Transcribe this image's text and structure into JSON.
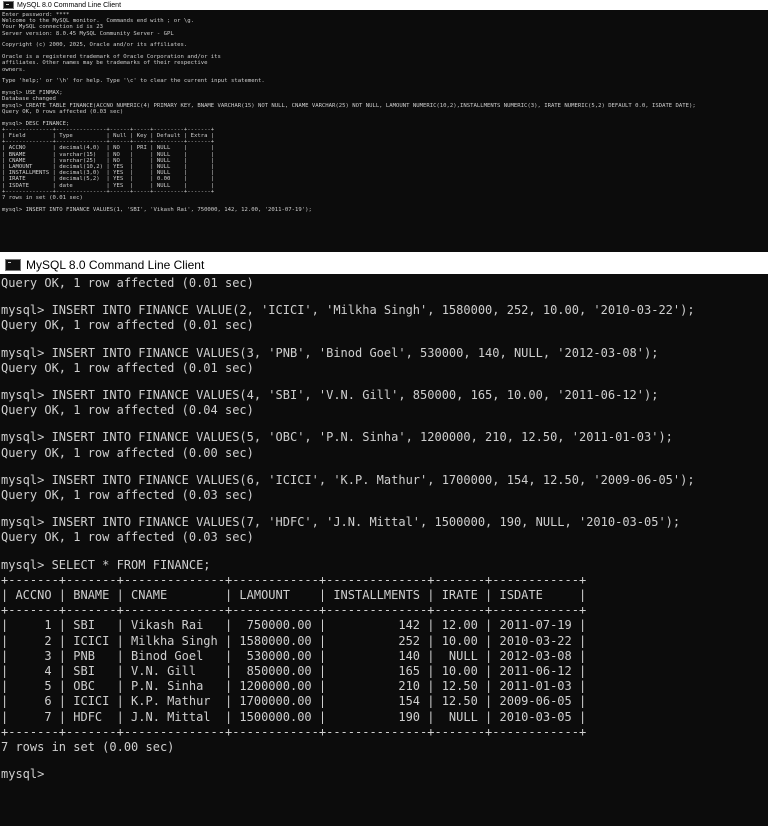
{
  "window1": {
    "title": "MySQL 8.0 Command Line Client",
    "lines": [
      "Enter password: ****",
      "Welcome to the MySQL monitor.  Commands end with ; or \\g.",
      "Your MySQL connection id is 23",
      "Server version: 8.0.45 MySQL Community Server - GPL",
      "",
      "Copyright (c) 2000, 2025, Oracle and/or its affiliates.",
      "",
      "Oracle is a registered trademark of Oracle Corporation and/or its",
      "affiliates. Other names may be trademarks of their respective",
      "owners.",
      "",
      "Type 'help;' or '\\h' for help. Type '\\c' to clear the current input statement.",
      "",
      "mysql> USE FINMAX;",
      "Database changed",
      "mysql> CREATE TABLE FINANCE(ACCNO NUMERIC(4) PRIMARY KEY, BNAME VARCHAR(15) NOT NULL, CNAME VARCHAR(25) NOT NULL, LAMOUNT NUMERIC(10,2),INSTALLMENTS NUMERIC(3), IRATE NUMERIC(5,2) DEFAULT 0.0, ISDATE DATE);",
      "Query OK, 0 rows affected (0.03 sec)",
      "",
      "mysql> DESC FINANCE;",
      "+--------------+---------------+------+-----+---------+-------+",
      "| Field        | Type          | Null | Key | Default | Extra |",
      "+--------------+---------------+------+-----+---------+-------+",
      "| ACCNO        | decimal(4,0)  | NO   | PRI | NULL    |       |",
      "| BNAME        | varchar(15)   | NO   |     | NULL    |       |",
      "| CNAME        | varchar(25)   | NO   |     | NULL    |       |",
      "| LAMOUNT      | decimal(10,2) | YES  |     | NULL    |       |",
      "| INSTALLMENTS | decimal(3,0)  | YES  |     | NULL    |       |",
      "| IRATE        | decimal(5,2)  | YES  |     | 0.00    |       |",
      "| ISDATE       | date          | YES  |     | NULL    |       |",
      "+--------------+---------------+------+-----+---------+-------+",
      "7 rows in set (0.01 sec)",
      "",
      "mysql> INSERT INTO FINANCE VALUES(1, 'SBI', 'Vikash Rai', 750000, 142, 12.00, '2011-07-19');"
    ]
  },
  "window2": {
    "title": "MySQL 8.0 Command Line Client",
    "lines": [
      "Query OK, 1 row affected (0.01 sec)",
      "",
      "mysql> INSERT INTO FINANCE VALUE(2, 'ICICI', 'Milkha Singh', 1580000, 252, 10.00, '2010-03-22');",
      "Query OK, 1 row affected (0.01 sec)",
      "",
      "mysql> INSERT INTO FINANCE VALUES(3, 'PNB', 'Binod Goel', 530000, 140, NULL, '2012-03-08');",
      "Query OK, 1 row affected (0.01 sec)",
      "",
      "mysql> INSERT INTO FINANCE VALUES(4, 'SBI', 'V.N. Gill', 850000, 165, 10.00, '2011-06-12');",
      "Query OK, 1 row affected (0.04 sec)",
      "",
      "mysql> INSERT INTO FINANCE VALUES(5, 'OBC', 'P.N. Sinha', 1200000, 210, 12.50, '2011-01-03');",
      "Query OK, 1 row affected (0.00 sec)",
      "",
      "mysql> INSERT INTO FINANCE VALUES(6, 'ICICI', 'K.P. Mathur', 1700000, 154, 12.50, '2009-06-05');",
      "Query OK, 1 row affected (0.03 sec)",
      "",
      "mysql> INSERT INTO FINANCE VALUES(7, 'HDFC', 'J.N. Mittal', 1500000, 190, NULL, '2010-03-05');",
      "Query OK, 1 row affected (0.03 sec)",
      "",
      "mysql> SELECT * FROM FINANCE;",
      "+-------+-------+--------------+------------+--------------+-------+------------+",
      "| ACCNO | BNAME | CNAME        | LAMOUNT    | INSTALLMENTS | IRATE | ISDATE     |",
      "+-------+-------+--------------+------------+--------------+-------+------------+",
      "|     1 | SBI   | Vikash Rai   |  750000.00 |          142 | 12.00 | 2011-07-19 |",
      "|     2 | ICICI | Milkha Singh | 1580000.00 |          252 | 10.00 | 2010-03-22 |",
      "|     3 | PNB   | Binod Goel   |  530000.00 |          140 |  NULL | 2012-03-08 |",
      "|     4 | SBI   | V.N. Gill    |  850000.00 |          165 | 10.00 | 2011-06-12 |",
      "|     5 | OBC   | P.N. Sinha   | 1200000.00 |          210 | 12.50 | 2011-01-03 |",
      "|     6 | ICICI | K.P. Mathur  | 1700000.00 |          154 | 12.50 | 2009-06-05 |",
      "|     7 | HDFC  | J.N. Mittal  | 1500000.00 |          190 |  NULL | 2010-03-05 |",
      "+-------+-------+--------------+------------+--------------+-------+------------+",
      "7 rows in set (0.00 sec)",
      "",
      "mysql>"
    ]
  }
}
